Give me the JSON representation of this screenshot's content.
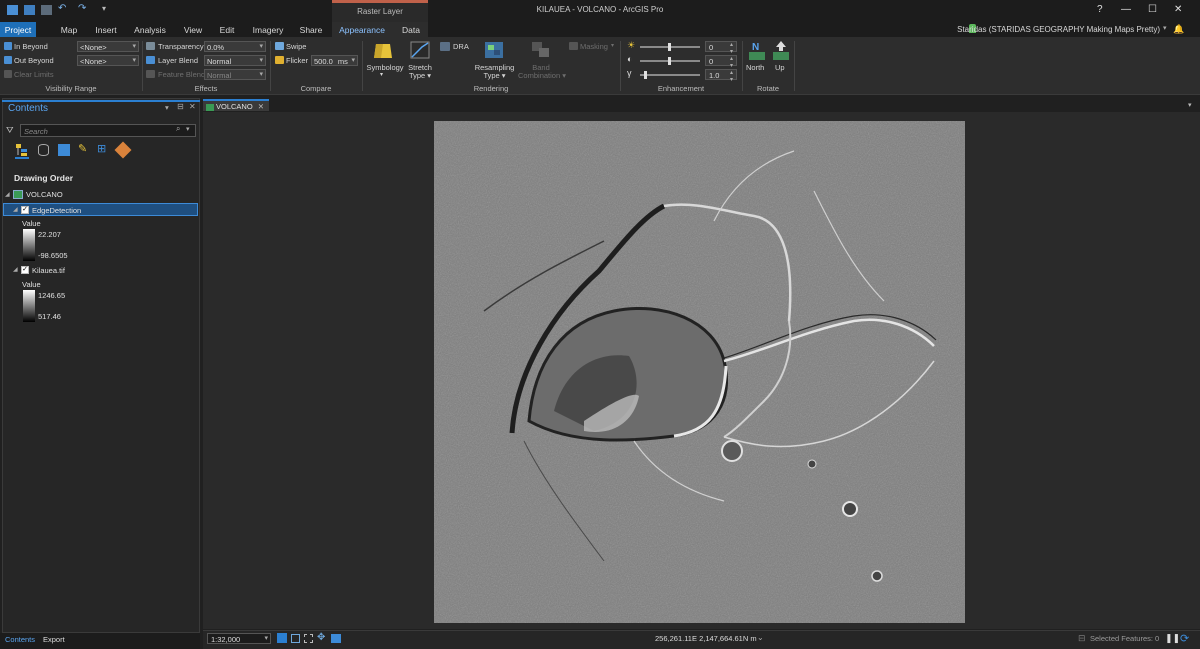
{
  "window": {
    "title": "KILAUEA - VOLCANO - ArcGIS Pro",
    "context_tab": "Raster Layer",
    "help": "?",
    "minimize": "—",
    "maximize": "☐",
    "close": "✕",
    "user": "Staridas (STARIDAS GEOGRAPHY Making Maps Pretty)"
  },
  "tabs": [
    "Project",
    "Map",
    "Insert",
    "Analysis",
    "View",
    "Edit",
    "Imagery",
    "Share",
    "Appearance",
    "Data"
  ],
  "ribbon": {
    "visibility": {
      "in_beyond": "In Beyond",
      "in_beyond_value": "<None>",
      "out_beyond": "Out Beyond",
      "out_beyond_value": "<None>",
      "clear_limits": "Clear Limits",
      "group": "Visibility Range"
    },
    "effects": {
      "transparency": "Transparency",
      "transparency_value": "0.0%",
      "layer_blend": "Layer Blend",
      "layer_blend_value": "Normal",
      "feature_blend": "Feature Blend",
      "feature_blend_value": "Normal",
      "group": "Effects"
    },
    "compare": {
      "swipe": "Swipe",
      "flicker": "Flicker",
      "flicker_value": "500.0",
      "flicker_unit": "ms",
      "group": "Compare"
    },
    "rendering": {
      "symbology": "Symbology",
      "stretch": "Stretch",
      "stretch_2": "Type",
      "dra": "DRA",
      "resampling": "Resampling",
      "resampling_2": "Type",
      "band": "Band",
      "band_2": "Combination",
      "masking": "Masking",
      "group": "Rendering"
    },
    "enhancement": {
      "brightness": "0",
      "contrast": "0",
      "gamma": "1.0",
      "group": "Enhancement"
    },
    "rotate": {
      "north": "North",
      "up": "Up",
      "group": "Rotate"
    }
  },
  "contents": {
    "title": "Contents",
    "pin": "⊟",
    "close": "✕",
    "search_placeholder": "Search",
    "heading": "Drawing Order",
    "map_name": "VOLCANO",
    "layers": [
      {
        "name": "EdgeDetection",
        "legend_title": "Value",
        "high": "22.207",
        "low": "-98.6505"
      },
      {
        "name": "Kilauea.tif",
        "legend_title": "Value",
        "high": "1246.65",
        "low": "517.46"
      }
    ]
  },
  "bottom_tabs": [
    "Contents",
    "Export"
  ],
  "map_view": {
    "tab": "VOLCANO",
    "scale": "1:32,000",
    "coordinates": "256,261.11E 2,147,664.61N m",
    "selected_features": "Selected Features: 0"
  },
  "colors": {
    "accent": "#1e6fb8",
    "active_tab_text": "#8cc2ff",
    "selection": "#1f4f80",
    "context_tab": "#c0614a"
  }
}
